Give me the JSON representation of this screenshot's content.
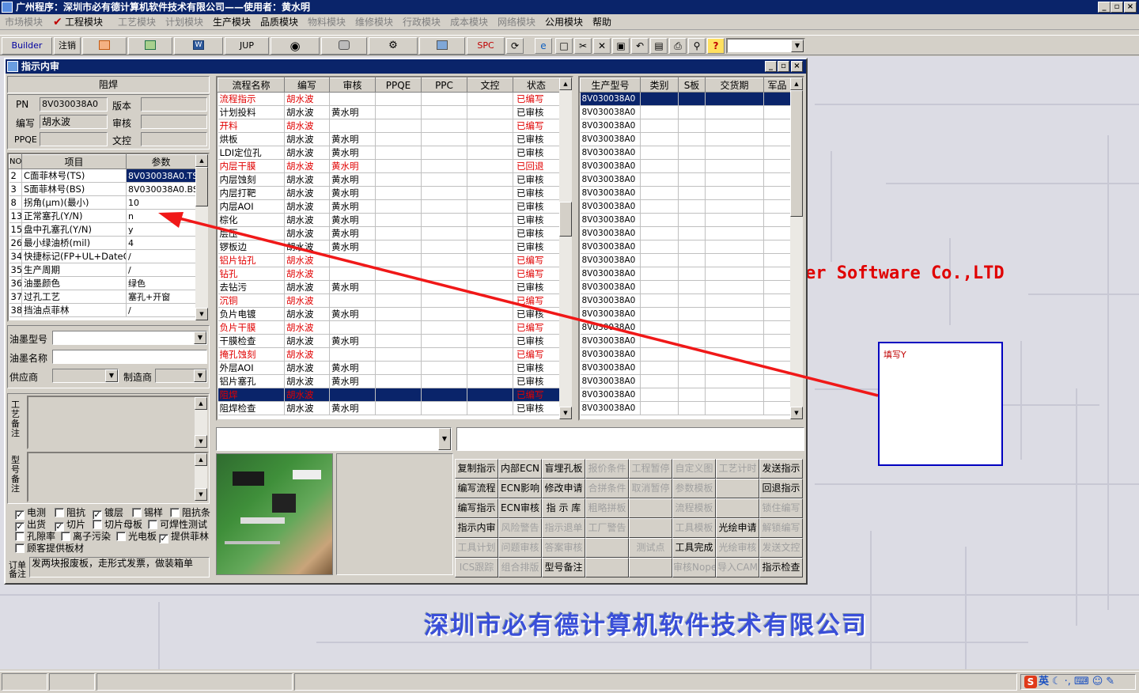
{
  "app": {
    "title": "广州程序：深圳市必有德计算机软件技术有限公司——使用者：黄水明",
    "minimize": "_",
    "restore": "▫",
    "close": "×"
  },
  "menu": [
    {
      "label": "市场模块",
      "enabled": false
    },
    {
      "label": "工程模块",
      "enabled": true,
      "checked": true
    },
    {
      "label": "工艺模块",
      "enabled": false
    },
    {
      "label": "计划模块",
      "enabled": false
    },
    {
      "label": "生产模块",
      "enabled": true
    },
    {
      "label": "品质模块",
      "enabled": true
    },
    {
      "label": "物料模块",
      "enabled": false
    },
    {
      "label": "维修模块",
      "enabled": false
    },
    {
      "label": "行政模块",
      "enabled": false
    },
    {
      "label": "成本模块",
      "enabled": false
    },
    {
      "label": "网络模块",
      "enabled": false
    },
    {
      "label": "公用模块",
      "enabled": true
    },
    {
      "label": "帮助",
      "enabled": true
    }
  ],
  "toolbar": {
    "builder": "Builder",
    "logout": "注销",
    "jup": "JUP",
    "spc": "SPC",
    "help": "?"
  },
  "desktop": {
    "brand_en": "er Software Co.,LTD",
    "brand_cn": "深圳市必有德计算机软件技术有限公司",
    "callout": "填写Y"
  },
  "window": {
    "title": "指示内审",
    "section": "阻焊",
    "pn_label": "PN",
    "pn_value": "8V030038A0",
    "version_label": "版本",
    "author_label": "编写",
    "author_value": "胡水波",
    "review_label": "审核",
    "ppqe_label": "PPQE",
    "doc_label": "文控",
    "params": {
      "headers": [
        "NO",
        "项目",
        "参数"
      ],
      "rows": [
        [
          "2",
          "C面菲林号(TS)",
          "8V030038A0.TS"
        ],
        [
          "3",
          "S面菲林号(BS)",
          "8V030038A0.BS"
        ],
        [
          "8",
          "拐角(μm)(最小)",
          "10"
        ],
        [
          "13",
          "正常塞孔(Y/N)",
          "n"
        ],
        [
          "15",
          "盘中孔塞孔(Y/N)",
          "y"
        ],
        [
          "26",
          "最小绿油桥(mil)",
          "4"
        ],
        [
          "34",
          "快捷标记(FP+UL+DateCo",
          "/"
        ],
        [
          "35",
          "生产周期",
          "/"
        ],
        [
          "36",
          "油墨颜色",
          "绿色"
        ],
        [
          "37",
          "过孔工艺",
          "塞孔+开窗"
        ],
        [
          "38",
          "挡油点菲林",
          "/"
        ]
      ]
    },
    "ink_type_label": "油墨型号",
    "ink_name_label": "油墨名称",
    "supplier_label": "供应商",
    "maker_label": "制造商",
    "process_note_label": "工艺备注",
    "model_note_label": "型号备注",
    "checks": [
      {
        "label": "电测",
        "checked": true
      },
      {
        "label": "阻抗",
        "checked": false
      },
      {
        "label": "镀层",
        "checked": true
      },
      {
        "label": "锡样",
        "checked": false
      },
      {
        "label": "阻抗条",
        "checked": false
      },
      {
        "label": "出货",
        "checked": true
      },
      {
        "label": "切片",
        "checked": true
      },
      {
        "label": "切片母板",
        "checked": false
      },
      {
        "label": "可焊性测试",
        "checked": false
      },
      {
        "label": "孔隙率",
        "checked": false
      },
      {
        "label": "离子污染",
        "checked": false
      },
      {
        "label": "光电板",
        "checked": false
      },
      {
        "label": "提供菲林",
        "checked": true
      },
      {
        "label": "顾客提供板材",
        "checked": false
      }
    ],
    "order_note_label": "订单备注",
    "order_note_value": "发两块报废板，走形式发票，做装箱单",
    "flow": {
      "headers": [
        "流程名称",
        "编写",
        "审核",
        "PPQE",
        "PPC",
        "文控",
        "状态"
      ],
      "rows": [
        {
          "c": [
            "流程指示",
            "胡水波",
            "",
            "",
            "",
            "",
            "已编写"
          ],
          "red": true
        },
        {
          "c": [
            "计划投料",
            "胡水波",
            "黄水明",
            "",
            "",
            "",
            "已审核"
          ]
        },
        {
          "c": [
            "开料",
            "胡水波",
            "",
            "",
            "",
            "",
            "已编写"
          ],
          "red": true
        },
        {
          "c": [
            "烘板",
            "胡水波",
            "黄水明",
            "",
            "",
            "",
            "已审核"
          ]
        },
        {
          "c": [
            "LDI定位孔",
            "胡水波",
            "黄水明",
            "",
            "",
            "",
            "已审核"
          ]
        },
        {
          "c": [
            "内层干膜",
            "胡水波",
            "黄水明",
            "",
            "",
            "",
            "已回退"
          ],
          "red": true
        },
        {
          "c": [
            "内层蚀刻",
            "胡水波",
            "黄水明",
            "",
            "",
            "",
            "已审核"
          ]
        },
        {
          "c": [
            "内层打靶",
            "胡水波",
            "黄水明",
            "",
            "",
            "",
            "已审核"
          ]
        },
        {
          "c": [
            "内层AOI",
            "胡水波",
            "黄水明",
            "",
            "",
            "",
            "已审核"
          ]
        },
        {
          "c": [
            "棕化",
            "胡水波",
            "黄水明",
            "",
            "",
            "",
            "已审核"
          ]
        },
        {
          "c": [
            "层压",
            "胡水波",
            "黄水明",
            "",
            "",
            "",
            "已审核"
          ]
        },
        {
          "c": [
            "锣板边",
            "胡水波",
            "黄水明",
            "",
            "",
            "",
            "已审核"
          ]
        },
        {
          "c": [
            "铝片钻孔",
            "胡水波",
            "",
            "",
            "",
            "",
            "已编写"
          ],
          "red": true
        },
        {
          "c": [
            "钻孔",
            "胡水波",
            "",
            "",
            "",
            "",
            "已编写"
          ],
          "red": true
        },
        {
          "c": [
            "去钻污",
            "胡水波",
            "黄水明",
            "",
            "",
            "",
            "已审核"
          ]
        },
        {
          "c": [
            "沉铜",
            "胡水波",
            "",
            "",
            "",
            "",
            "已编写"
          ],
          "red": true
        },
        {
          "c": [
            "负片电镀",
            "胡水波",
            "黄水明",
            "",
            "",
            "",
            "已审核"
          ]
        },
        {
          "c": [
            "负片干膜",
            "胡水波",
            "",
            "",
            "",
            "",
            "已编写"
          ],
          "red": true
        },
        {
          "c": [
            "干膜检查",
            "胡水波",
            "黄水明",
            "",
            "",
            "",
            "已审核"
          ]
        },
        {
          "c": [
            "掩孔蚀刻",
            "胡水波",
            "",
            "",
            "",
            "",
            "已编写"
          ],
          "red": true
        },
        {
          "c": [
            "外层AOI",
            "胡水波",
            "黄水明",
            "",
            "",
            "",
            "已审核"
          ]
        },
        {
          "c": [
            "铝片塞孔",
            "胡水波",
            "黄水明",
            "",
            "",
            "",
            "已审核"
          ]
        },
        {
          "c": [
            "阻焊",
            "胡水波",
            "",
            "",
            "",
            "",
            "已编写"
          ],
          "red": true,
          "sel": true
        },
        {
          "c": [
            "阻焊检查",
            "胡水波",
            "黄水明",
            "",
            "",
            "",
            "已审核"
          ]
        }
      ]
    },
    "models": {
      "headers": [
        "生产型号",
        "类别",
        "S板",
        "交货期",
        "军品"
      ],
      "value": "8V030038A0",
      "count": 24
    },
    "buttons": [
      [
        {
          "l": "复制指示",
          "e": true
        },
        {
          "l": "内部ECN",
          "e": true
        },
        {
          "l": "盲埋孔板",
          "e": true
        },
        {
          "l": "报价条件",
          "e": false
        },
        {
          "l": "工程暂停",
          "e": false
        },
        {
          "l": "自定义图",
          "e": false
        },
        {
          "l": "工艺计时",
          "e": false
        },
        {
          "l": "发送指示",
          "e": true
        }
      ],
      [
        {
          "l": "编写流程",
          "e": true
        },
        {
          "l": "ECN影响",
          "e": true
        },
        {
          "l": "修改申请",
          "e": true
        },
        {
          "l": "合拼条件",
          "e": false
        },
        {
          "l": "取消暂停",
          "e": false
        },
        {
          "l": "参数模板",
          "e": false
        },
        {
          "l": "",
          "e": false
        },
        {
          "l": "回退指示",
          "e": true
        }
      ],
      [
        {
          "l": "编写指示",
          "e": true
        },
        {
          "l": "ECN审核",
          "e": true
        },
        {
          "l": "指 示 库",
          "e": true
        },
        {
          "l": "粗略拼板",
          "e": false
        },
        {
          "l": "",
          "e": false
        },
        {
          "l": "流程模板",
          "e": false
        },
        {
          "l": "",
          "e": false
        },
        {
          "l": "锁住编写",
          "e": false
        }
      ],
      [
        {
          "l": "指示内审",
          "e": true
        },
        {
          "l": "风险警告",
          "e": false
        },
        {
          "l": "指示退单",
          "e": false
        },
        {
          "l": "工厂警告",
          "e": false
        },
        {
          "l": "",
          "e": false
        },
        {
          "l": "工具模板",
          "e": false
        },
        {
          "l": "光绘申请",
          "e": true
        },
        {
          "l": "解锁编写",
          "e": false
        }
      ],
      [
        {
          "l": "工具计划",
          "e": false
        },
        {
          "l": "问题审核",
          "e": false
        },
        {
          "l": "答案审核",
          "e": false
        },
        {
          "l": "",
          "e": false
        },
        {
          "l": "测试点",
          "e": false
        },
        {
          "l": "工具完成",
          "e": true
        },
        {
          "l": "光绘审核",
          "e": false
        },
        {
          "l": "发送文控",
          "e": false
        }
      ],
      [
        {
          "l": "ICS跟踪",
          "e": false
        },
        {
          "l": "组合排版",
          "e": false
        },
        {
          "l": "型号备注",
          "e": true
        },
        {
          "l": "",
          "e": false
        },
        {
          "l": "",
          "e": false
        },
        {
          "l": "审核Nope",
          "e": false
        },
        {
          "l": "导入CAM",
          "e": false
        },
        {
          "l": "指示检查",
          "e": true
        }
      ]
    ]
  },
  "tray": {
    "ime_label": "英"
  }
}
